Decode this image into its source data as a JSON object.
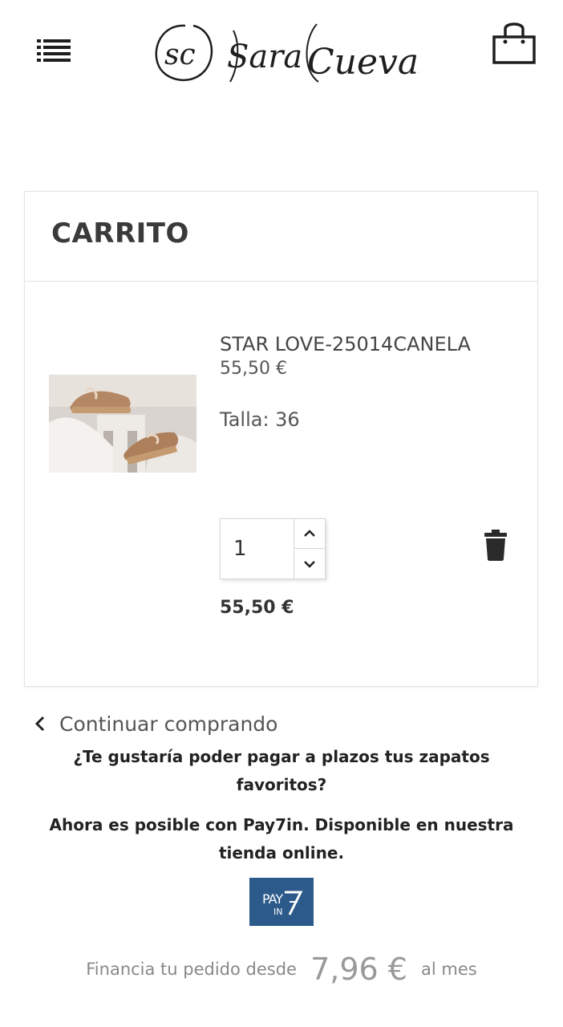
{
  "brand": {
    "monogram": "SC",
    "name": "Sara Cuevas"
  },
  "header": {
    "menu_icon": "list-menu-icon",
    "cart_icon": "shopping-bag-icon"
  },
  "cart": {
    "title": "CARRITO",
    "item": {
      "name": "STAR LOVE-25014CANELA",
      "price": "55,50 €",
      "size": "Talla: 36",
      "quantity": "1",
      "total": "55,50 €",
      "image_desc": "platform-sneakers-photo"
    }
  },
  "continue_shopping": "Continuar comprando",
  "promo": {
    "question": "¿Te gustaría poder pagar a plazos tus zapatos favoritos?",
    "answer": "Ahora es posible con Pay7in. Disponible en nuestra tienda online.",
    "pay7_logo_text": "PAY IN 7"
  },
  "financing": {
    "prefix": "Financia tu pedido desde",
    "amount": "7,96 €",
    "suffix": "al mes"
  },
  "colors": {
    "pay7_blue": "#2c5a8a",
    "text_dark": "#333333",
    "border": "#e3e3e3"
  }
}
